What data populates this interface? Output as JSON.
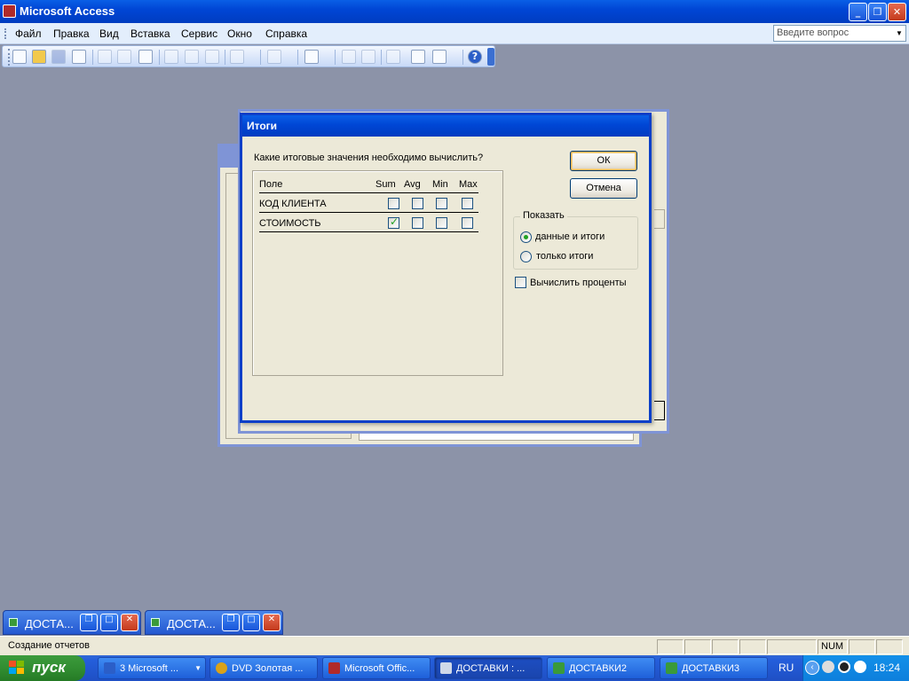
{
  "app": {
    "title": "Microsoft Access"
  },
  "menu": [
    "Файл",
    "Правка",
    "Вид",
    "Вставка",
    "Сервис",
    "Окно",
    "Справка"
  ],
  "help_placeholder": "Введите вопрос",
  "dialog": {
    "title": "Итоги",
    "question": "Какие итоговые значения необходимо вычислить?",
    "headers": {
      "field": "Поле",
      "sum": "Sum",
      "avg": "Avg",
      "min": "Min",
      "max": "Max"
    },
    "rows": [
      {
        "field": "КОД КЛИЕНТА",
        "sum": false,
        "avg": false,
        "min": false,
        "max": false
      },
      {
        "field": "СТОИМОСТЬ",
        "sum": true,
        "avg": false,
        "min": false,
        "max": false
      }
    ],
    "ok_label": "ОК",
    "cancel_label": "Отмена",
    "show_group": {
      "legend": "Показать",
      "options": [
        "данные и итоги",
        "только итоги"
      ],
      "selected": 0
    },
    "percent_label": "Вычислить проценты",
    "percent_checked": false
  },
  "minimized": [
    {
      "label": "ДОСТА..."
    },
    {
      "label": "ДОСТА..."
    }
  ],
  "status": {
    "text": "Создание отчетов",
    "num": "NUM"
  },
  "taskbar": {
    "start_label": "пуск",
    "tasks": [
      {
        "label": "3 Microsoft ...",
        "icon_color": "#2b5ec8"
      },
      {
        "label": "DVD  Золотая ...",
        "icon_color": "#d9a21a"
      },
      {
        "label": "Microsoft Offic...",
        "icon_color": "#b02a2a"
      },
      {
        "label": "ДОСТАВКИ : ...",
        "icon_color": "#cfd8e8"
      },
      {
        "label": "ДОСТАВКИ2",
        "icon_color": "#3a9a3a"
      },
      {
        "label": "ДОСТАВКИ3",
        "icon_color": "#3a9a3a"
      }
    ],
    "active_task": 3,
    "lang": "RU",
    "clock": "18:24"
  }
}
